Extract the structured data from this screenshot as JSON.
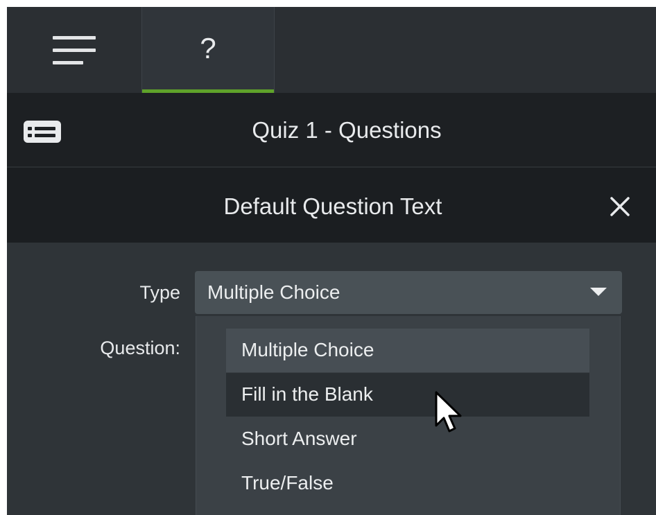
{
  "tabs": {
    "menu_icon": "hamburger-icon",
    "quiz_glyph": "?"
  },
  "quiz_header": {
    "icon": "list-icon",
    "title": "Quiz 1 - Questions"
  },
  "question_header": {
    "title": "Default Question Text",
    "close_icon": "close-icon"
  },
  "form": {
    "type_label": "Type",
    "question_label": "Question:",
    "type_select": {
      "selected": "Multiple Choice",
      "options": [
        "Multiple Choice",
        "Fill in the Blank",
        "Short Answer",
        "True/False"
      ],
      "hovered": "Fill in the Blank"
    }
  },
  "colors": {
    "accent_tab": "#5fa32a",
    "panel_bg": "#2f3438",
    "header_bg": "#1d2023",
    "select_bg": "#495156",
    "dropdown_bg": "#3b4146",
    "text": "#e8eaec"
  }
}
